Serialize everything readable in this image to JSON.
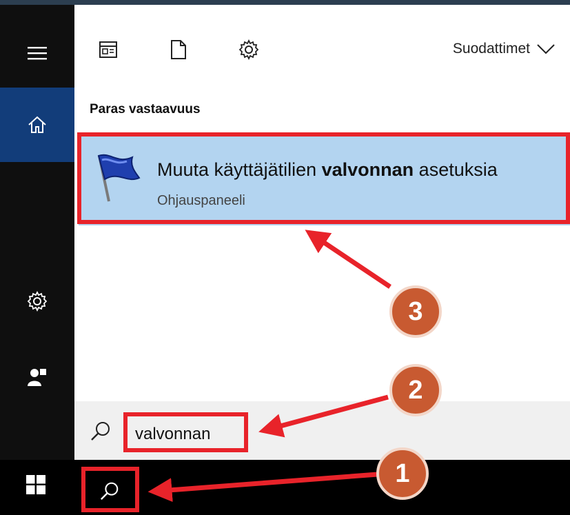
{
  "toolbar": {
    "filters_label": "Suodattimet"
  },
  "results": {
    "section_title": "Paras vastaavuus",
    "best_match": {
      "title_prefix": "Muuta käyttäjätilien ",
      "title_bold": "valvonnan",
      "title_suffix": " asetuksia",
      "subtitle": "Ohjauspaneeli"
    }
  },
  "search": {
    "value": "valvonnan"
  },
  "annotations": {
    "step1": "1",
    "step2": "2",
    "step3": "3"
  },
  "colors": {
    "sidebar_bg": "#0f0f0f",
    "home_active": "#123d7a",
    "result_highlight": "#b3d4f0",
    "annotation_red": "#e8232a",
    "badge_orange": "#c85a31"
  }
}
